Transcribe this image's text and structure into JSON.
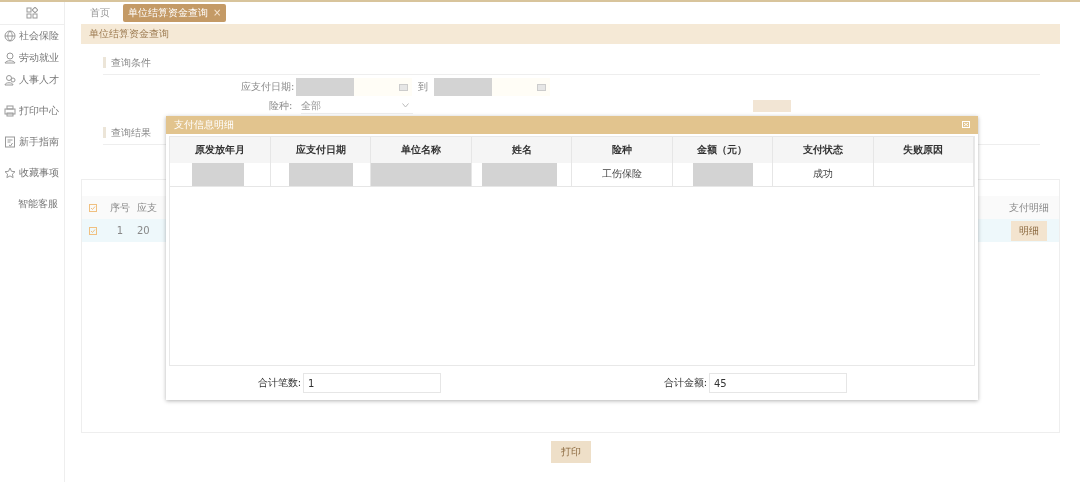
{
  "sidebar": {
    "items": [
      {
        "label": "社会保险"
      },
      {
        "label": "劳动就业"
      },
      {
        "label": "人事人才"
      },
      {
        "label": "打印中心"
      },
      {
        "label": "新手指南"
      },
      {
        "label": "收藏事项"
      },
      {
        "label": "智能客服"
      }
    ]
  },
  "tabs": [
    {
      "label": "首页",
      "selected": false
    },
    {
      "label": "单位结算资金查询",
      "selected": true,
      "close": "×"
    }
  ],
  "panel": {
    "title": "单位结算资金查询",
    "conditions": {
      "title": "查询条件",
      "date_label": "应支付日期:",
      "date_from": {
        "redacted": true
      },
      "to_label": "到",
      "date_to": {
        "redacted": true
      },
      "insurance_label": "险种:",
      "insurance_value": "全部"
    },
    "results": {
      "title": "查询结果",
      "columns": [
        "序号",
        "应支",
        "支付明细"
      ],
      "rows": [
        {
          "index": "1",
          "column_2": "20",
          "action": "明细"
        }
      ]
    },
    "print_button": "打印"
  },
  "modal": {
    "title": "支付信息明细",
    "columns": [
      "原发放年月",
      "应支付日期",
      "单位名称",
      "姓名",
      "险种",
      "金额（元）",
      "支付状态",
      "失败原因"
    ],
    "rows": [
      {
        "cells": [
          {
            "redacted": true
          },
          {
            "redacted": true
          },
          {
            "redacted": true
          },
          {
            "redacted": true
          },
          {
            "text": "工伤保险"
          },
          {
            "redacted": true
          },
          {
            "text": "成功"
          },
          {}
        ]
      }
    ],
    "total_count_label": "合计笔数:",
    "total_count": "1",
    "total_amount_label": "合计金额:",
    "total_amount": "45"
  }
}
